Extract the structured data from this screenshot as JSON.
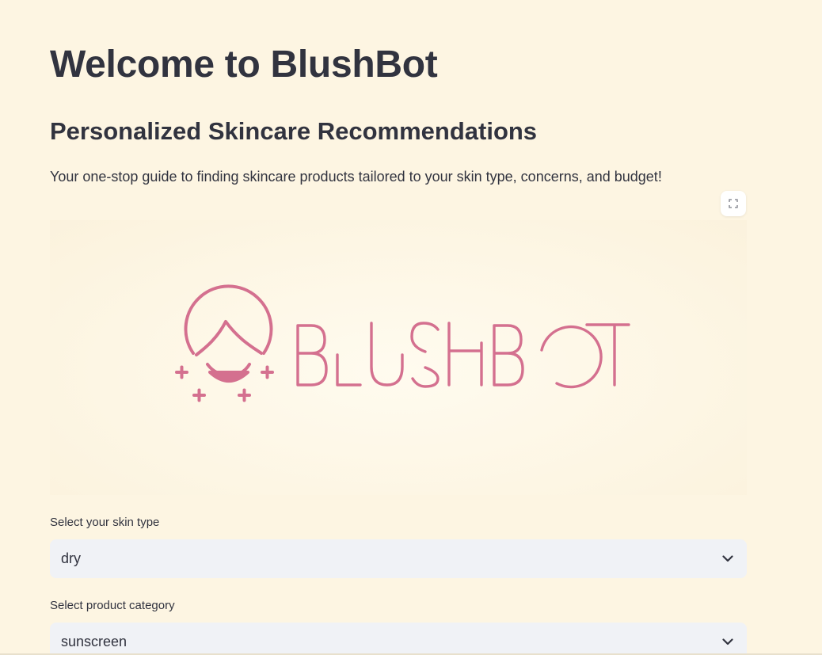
{
  "page": {
    "title": "Welcome to BlushBot",
    "subtitle": "Personalized Skincare Recommendations",
    "tagline": "Your one-stop guide to finding skincare products tailored to your skin type, concerns, and budget!"
  },
  "logo": {
    "wordmark": "BLUSHBOT",
    "icon": "girl-face-icon",
    "color": "#d4708f"
  },
  "form": {
    "skin_type": {
      "label": "Select your skin type",
      "value": "dry"
    },
    "product_category": {
      "label": "Select product category",
      "value": "sunscreen"
    }
  },
  "colors": {
    "background": "#fdf5e2",
    "text": "#31333f",
    "select_bg": "#f0f2f6"
  }
}
